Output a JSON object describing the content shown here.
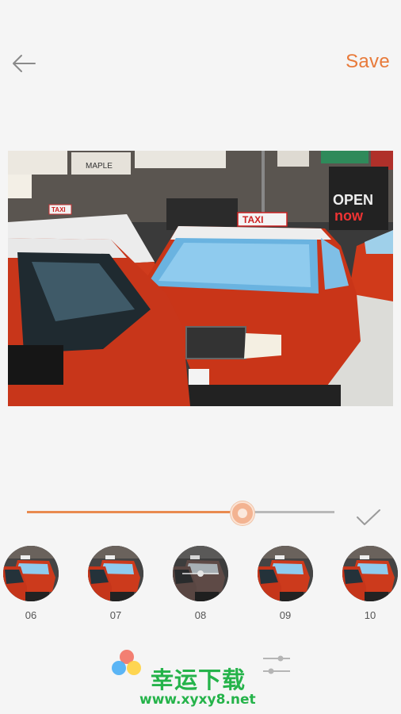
{
  "toolbar": {
    "back_icon": "back-arrow-icon",
    "save_label": "Save",
    "accent_color": "#e87a3a"
  },
  "photo": {
    "description_icon": "photo-preview",
    "taxi_sign": "TAXI",
    "shop_sign": "MAPLE",
    "open_sign_1": "OPEN",
    "open_sign_2": "now"
  },
  "intensity_slider": {
    "value_fraction": 0.7,
    "fill_color": "#e98a4f"
  },
  "confirm_icon": "checkmark-icon",
  "filters": [
    {
      "label": "06",
      "selected": false
    },
    {
      "label": "07",
      "selected": false
    },
    {
      "label": "08",
      "selected": true
    },
    {
      "label": "09",
      "selected": false
    },
    {
      "label": "10",
      "selected": false
    }
  ],
  "adjust_icon": "sliders-icon",
  "watermark": {
    "title": "幸运下载",
    "url": "www.xyxy8.net",
    "color": "#25b34a"
  }
}
